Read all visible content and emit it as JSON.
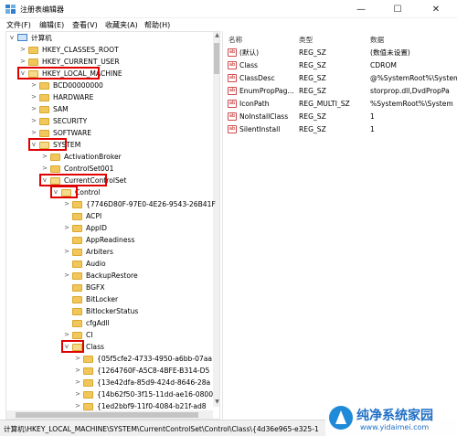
{
  "window": {
    "title": "注册表编辑器",
    "min_glyph": "—",
    "max_glyph": "☐",
    "close_glyph": "✕"
  },
  "menu": [
    "文件(F)",
    "编辑(E)",
    "查看(V)",
    "收藏夹(A)",
    "帮助(H)"
  ],
  "tree": {
    "root": "计算机",
    "nodes": [
      {
        "label": "HKEY_CLASSES_ROOT",
        "expander": ">"
      },
      {
        "label": "HKEY_CURRENT_USER",
        "expander": ">"
      },
      {
        "label": "HKEY_LOCAL_MACHINE",
        "expander": "v",
        "highlighted": true
      },
      {
        "label": "BCD00000000",
        "expander": ">"
      },
      {
        "label": "HARDWARE",
        "expander": ">"
      },
      {
        "label": "SAM",
        "expander": ">"
      },
      {
        "label": "SECURITY",
        "expander": ">"
      },
      {
        "label": "SOFTWARE",
        "expander": ">"
      },
      {
        "label": "SYSTEM",
        "expander": "v",
        "highlighted": true
      },
      {
        "label": "ActivationBroker",
        "expander": ">"
      },
      {
        "label": "ControlSet001",
        "expander": ">"
      },
      {
        "label": "CurrentControlSet",
        "expander": "v",
        "highlighted": true
      },
      {
        "label": "Control",
        "expander": "v",
        "highlighted": true
      },
      {
        "label": "{7746D80F-97E0-4E26-9543-26B41F",
        "expander": ">"
      },
      {
        "label": "ACPI",
        "expander": ""
      },
      {
        "label": "AppID",
        "expander": ">"
      },
      {
        "label": "AppReadiness",
        "expander": ""
      },
      {
        "label": "Arbiters",
        "expander": ">"
      },
      {
        "label": "Audio",
        "expander": ""
      },
      {
        "label": "BackupRestore",
        "expander": ">"
      },
      {
        "label": "BGFX",
        "expander": ""
      },
      {
        "label": "BitLocker",
        "expander": ""
      },
      {
        "label": "BitlockerStatus",
        "expander": ""
      },
      {
        "label": "cfgAdll",
        "expander": ""
      },
      {
        "label": "CI",
        "expander": ">"
      },
      {
        "label": "Class",
        "expander": "v",
        "highlighted": true
      },
      {
        "label": "{05f5cfe2-4733-4950-a6bb-07aa",
        "expander": ">"
      },
      {
        "label": "{1264760F-A5C8-4BFE-B314-D5",
        "expander": ">"
      },
      {
        "label": "{13e42dfa-85d9-424d-8646-28a",
        "expander": ">"
      },
      {
        "label": "{14b62f50-3f15-11dd-ae16-0800",
        "expander": ">"
      },
      {
        "label": "{1ed2bbf9-11f0-4084-b21f-ad8",
        "expander": ">"
      }
    ]
  },
  "list": {
    "headers": {
      "name": "名称",
      "type": "类型",
      "data": "数据"
    },
    "rows": [
      {
        "name": "(默认)",
        "type": "REG_SZ",
        "data": "(数值未设置)"
      },
      {
        "name": "Class",
        "type": "REG_SZ",
        "data": "CDROM"
      },
      {
        "name": "ClassDesc",
        "type": "REG_SZ",
        "data": "@%SystemRoot%\\System"
      },
      {
        "name": "EnumPropPag...",
        "type": "REG_SZ",
        "data": "storprop.dll,DvdPropPa"
      },
      {
        "name": "IconPath",
        "type": "REG_MULTI_SZ",
        "data": "%SystemRoot%\\System"
      },
      {
        "name": "NoInstallClass",
        "type": "REG_SZ",
        "data": "1"
      },
      {
        "name": "SilentInstall",
        "type": "REG_SZ",
        "data": "1"
      }
    ],
    "value_icon_text": "ab"
  },
  "status": {
    "path": "计算机\\HKEY_LOCAL_MACHINE\\SYSTEM\\CurrentControlSet\\Control\\Class\\{4d36e965-e325-1"
  },
  "watermark": {
    "title": "纯净系统家园",
    "url": "www.yidaimei.com"
  },
  "colors": {
    "highlight_border": "#e00000",
    "folder": "#f1c65a",
    "watermark_blue": "#1f6fc6"
  }
}
